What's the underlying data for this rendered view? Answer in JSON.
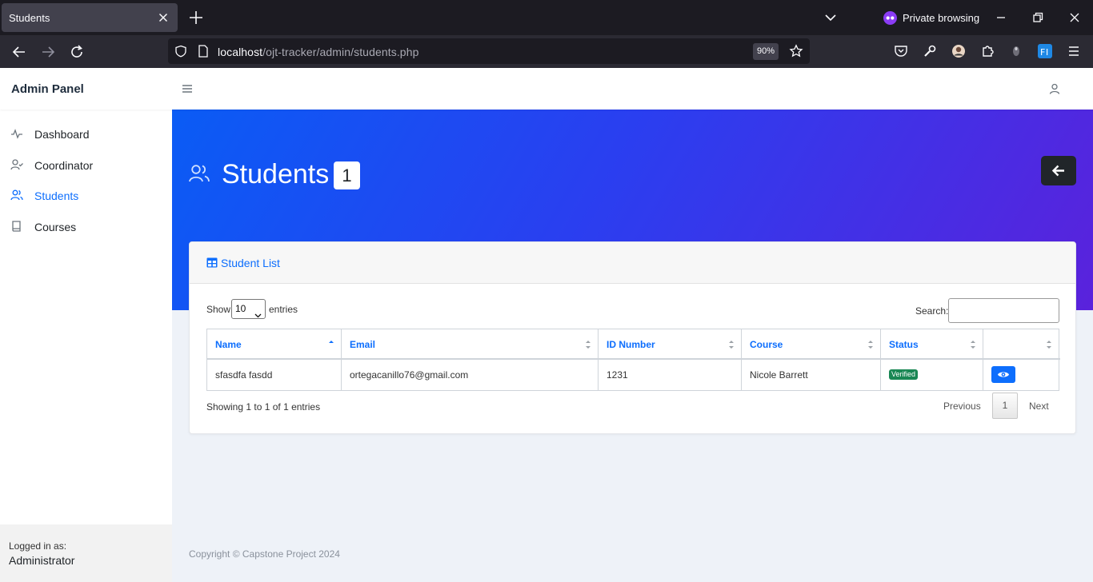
{
  "browser": {
    "tab_title": "Students",
    "tab_close_icon": "close-icon",
    "private_label": "Private browsing",
    "url_host": "localhost",
    "url_path": "/ojt-tracker/admin/students.php",
    "zoom": "90%"
  },
  "app": {
    "brand": "Admin Panel",
    "sidebar": {
      "items": [
        {
          "label": "Dashboard",
          "icon": "activity-icon",
          "active": false
        },
        {
          "label": "Coordinator",
          "icon": "user-check-icon",
          "active": false
        },
        {
          "label": "Students",
          "icon": "users-icon",
          "active": true
        },
        {
          "label": "Courses",
          "icon": "book-icon",
          "active": false
        }
      ],
      "footer_small": "Logged in as:",
      "footer_user": "Administrator"
    },
    "hero": {
      "title": "Students",
      "count": "1"
    },
    "card": {
      "title": "Student List",
      "show_label": "Show",
      "show_value": "10",
      "entries_label": "entries",
      "search_label": "Search:",
      "columns": [
        "Name",
        "Email",
        "ID Number",
        "Course",
        "Status",
        ""
      ],
      "rows": [
        {
          "name": "sfasdfa fasdd",
          "email": "ortegacanillo76@gmail.com",
          "id_number": "1231",
          "course": "Nicole Barrett",
          "status": "Verified"
        }
      ],
      "info": "Showing 1 to 1 of 1 entries",
      "previous": "Previous",
      "page": "1",
      "next": "Next"
    },
    "footer": "Copyright © Capstone Project 2024",
    "colors": {
      "primary": "#0d6efd",
      "success": "#198754",
      "dark": "#212529"
    }
  }
}
